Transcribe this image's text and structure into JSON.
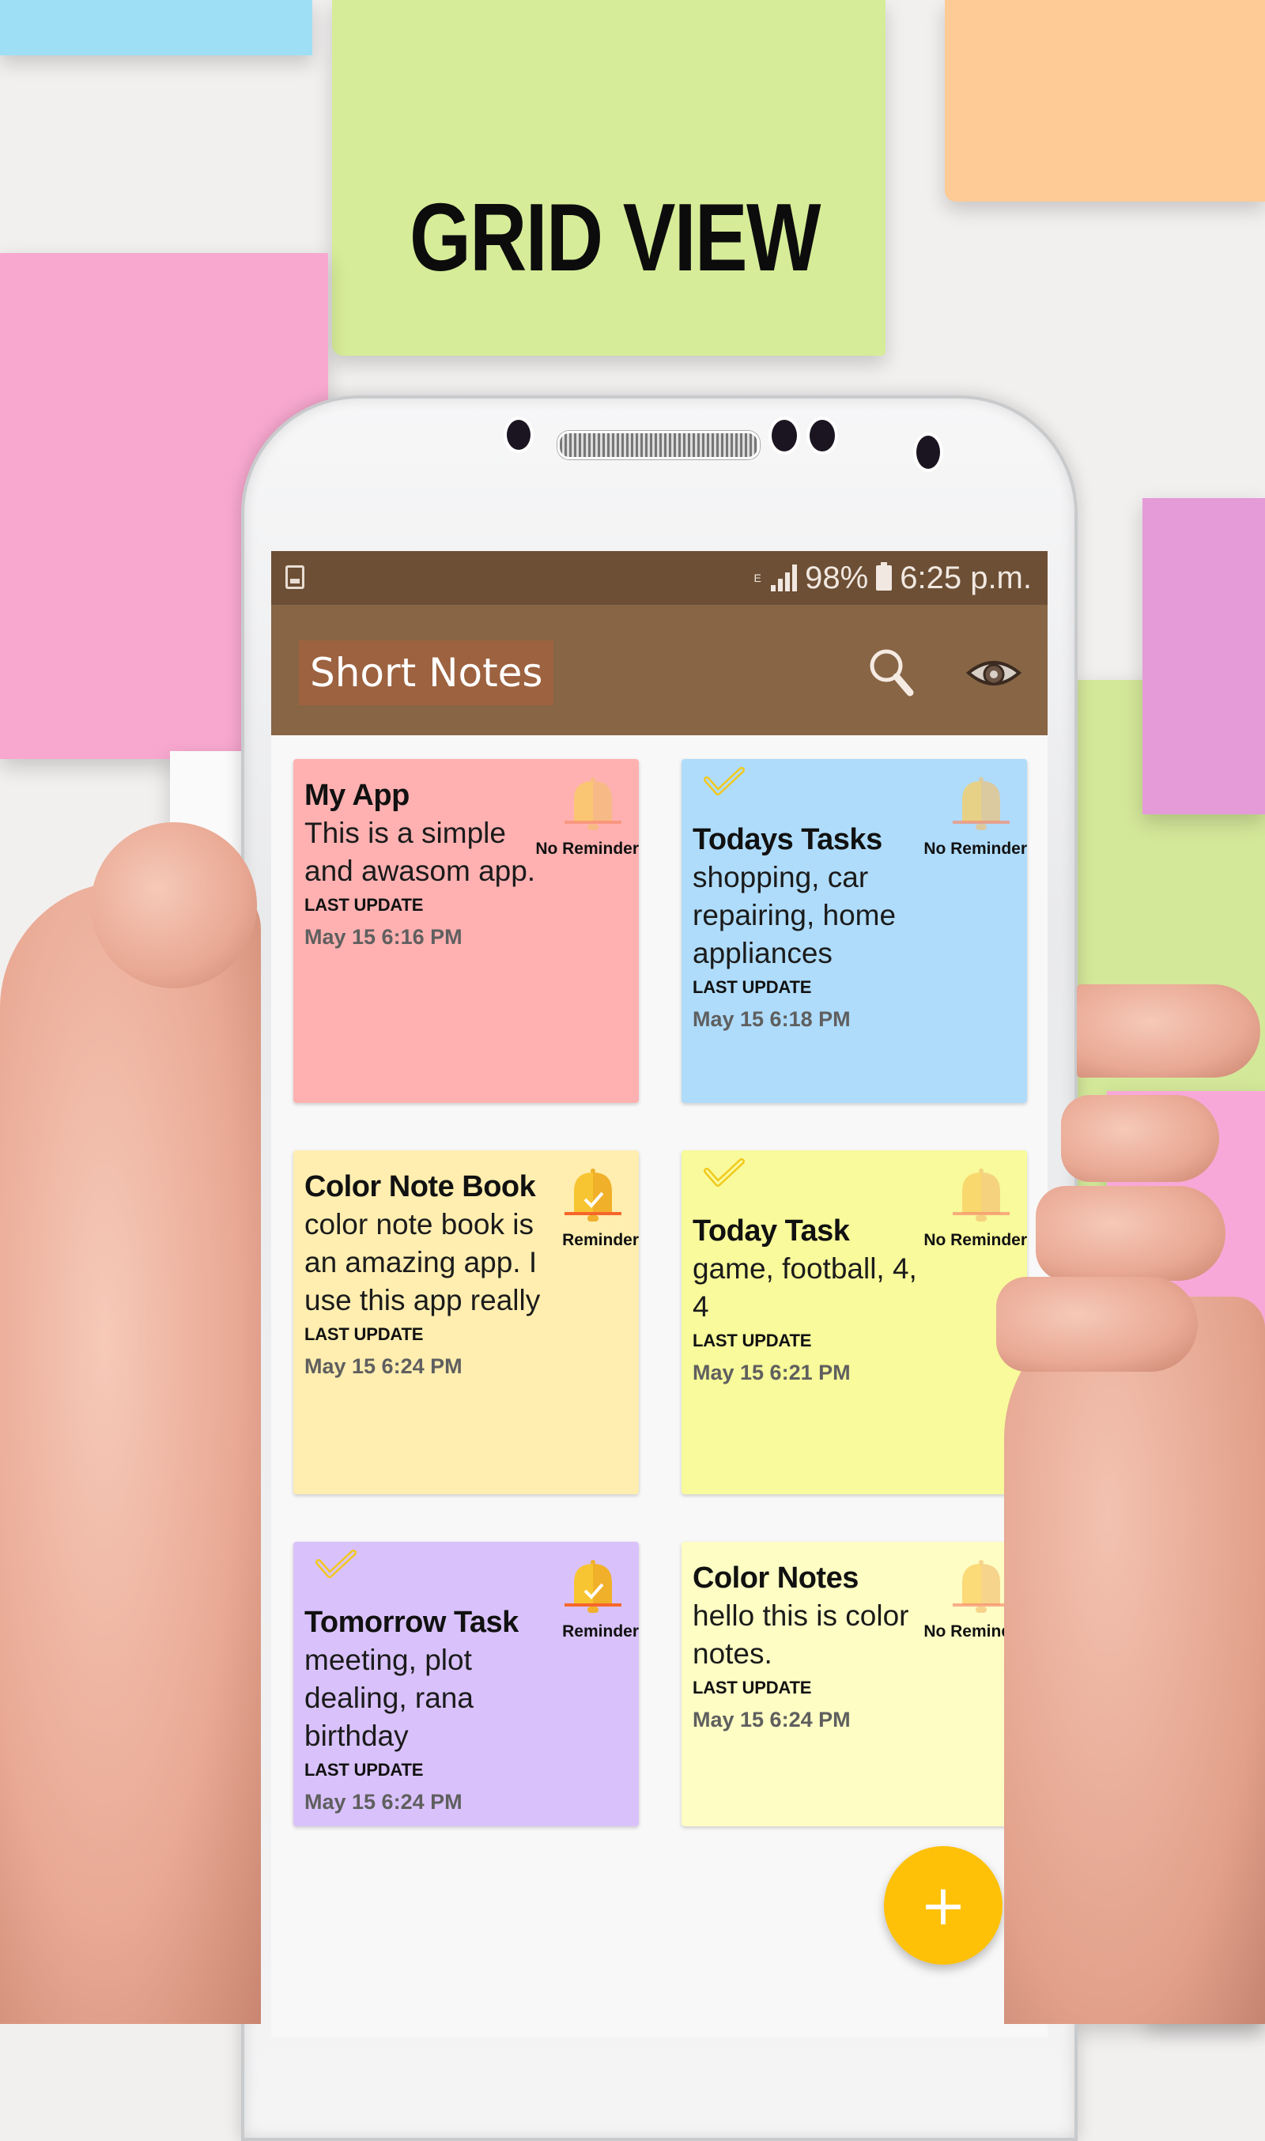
{
  "banner": {
    "title": "GRID VIEW"
  },
  "status_bar": {
    "network_type": "E",
    "battery_percent": "98%",
    "time": "6:25 p.m.",
    "left_icon": "image-notification-icon",
    "signal_icon": "signal-strength-icon",
    "battery_icon": "battery-icon"
  },
  "app_bar": {
    "title": "Short Notes",
    "actions": [
      {
        "name": "search",
        "icon": "search-icon"
      },
      {
        "name": "view-toggle",
        "icon": "eye-icon"
      }
    ],
    "colors": {
      "status_bar": "#6c4f35",
      "app_bar": "#876545",
      "title_highlight": "#9d6240"
    }
  },
  "notes": [
    {
      "title": "My App",
      "body": "This is a simple and awasom app.",
      "last_update_label": "LAST UPDATE",
      "last_update": "May 15 6:16 PM",
      "reminder_label": "No Reminder",
      "reminder_set": false,
      "checked": false,
      "color": "#ffb1b1"
    },
    {
      "title": "Todays Tasks",
      "body": "shopping, car repairing, home appliances",
      "last_update_label": "LAST UPDATE",
      "last_update": "May 15 6:18 PM",
      "reminder_label": "No Reminder",
      "reminder_set": false,
      "checked": true,
      "color": "#afdcfb"
    },
    {
      "title": "Color Note Book",
      "body": "color note book is an amazing app. I use this app really",
      "last_update_label": "LAST UPDATE",
      "last_update": "May 15 6:24 PM",
      "reminder_label": "Reminder",
      "reminder_set": true,
      "checked": false,
      "color": "#ffeeb0"
    },
    {
      "title": "Today Task",
      "body": "game, football, 4, 4",
      "last_update_label": "LAST UPDATE",
      "last_update": "May 15 6:21 PM",
      "reminder_label": "No Reminder",
      "reminder_set": false,
      "checked": true,
      "color": "#f8fa9b"
    },
    {
      "title": "Tomorrow Task",
      "body": "meeting, plot dealing, rana birthday",
      "last_update_label": "LAST UPDATE",
      "last_update": "May 15 6:24 PM",
      "reminder_label": "Reminder",
      "reminder_set": true,
      "checked": true,
      "color": "#d9c2fb"
    },
    {
      "title": "Color Notes",
      "body": "hello this is color notes.",
      "last_update_label": "LAST UPDATE",
      "last_update": "May 15 6:24 PM",
      "reminder_label": "No Reminder",
      "reminder_set": false,
      "checked": false,
      "color": "#fdfdc4"
    }
  ],
  "fab": {
    "label": "+",
    "icon": "add-icon",
    "color": "#ffc107"
  }
}
